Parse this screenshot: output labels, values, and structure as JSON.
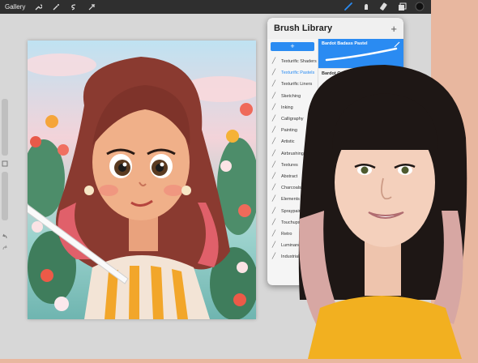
{
  "topbar": {
    "gallery_label": "Gallery",
    "left_icons": [
      "wrench-icon",
      "magic-wand-icon",
      "selection-s-icon",
      "arrow-transform-icon"
    ],
    "right_icons": [
      "brush-icon",
      "smudge-icon",
      "eraser-icon",
      "layers-icon",
      "color-swatch-icon"
    ]
  },
  "brush_library": {
    "title": "Brush Library",
    "add_symbol": "+",
    "new_set_symbol": "+",
    "sets": [
      {
        "label": "Texturific Shaders",
        "icon": "brush-stroke-icon",
        "selected": false
      },
      {
        "label": "Texturific Pastels",
        "icon": "brush-stroke-icon",
        "selected": true
      },
      {
        "label": "Texturific Liners",
        "icon": "brush-stroke-icon",
        "selected": false
      },
      {
        "label": "Sketching",
        "icon": "pencil-icon",
        "selected": false
      },
      {
        "label": "Inking",
        "icon": "ink-drop-icon",
        "selected": false
      },
      {
        "label": "Calligraphy",
        "icon": "calligraphy-icon",
        "selected": false
      },
      {
        "label": "Painting",
        "icon": "paint-drop-icon",
        "selected": false
      },
      {
        "label": "Artistic",
        "icon": "palette-icon",
        "selected": false
      },
      {
        "label": "Airbrushing",
        "icon": "airbrush-icon",
        "selected": false
      },
      {
        "label": "Textures",
        "icon": "texture-icon",
        "selected": false
      },
      {
        "label": "Abstract",
        "icon": "triangle-icon",
        "selected": false
      },
      {
        "label": "Charcoals",
        "icon": "charcoal-icon",
        "selected": false
      },
      {
        "label": "Elements",
        "icon": "yin-yang-icon",
        "selected": false
      },
      {
        "label": "Spraypaints",
        "icon": "spray-can-icon",
        "selected": false
      },
      {
        "label": "Touchups",
        "icon": "touchup-icon",
        "selected": false
      },
      {
        "label": "Retro",
        "icon": "retro-icon",
        "selected": false
      },
      {
        "label": "Luminance",
        "icon": "luminance-icon",
        "selected": false
      },
      {
        "label": "Industrial",
        "icon": "industrial-icon",
        "selected": false
      }
    ],
    "brushes": [
      {
        "name": "Bardot Badass Pastel",
        "selected": true
      },
      {
        "name": "Bardot Gossamer Pastel",
        "selected": false
      }
    ]
  },
  "colors": {
    "accent": "#2a8bf2",
    "topbar": "#2f2f2f",
    "background_peach": "#e8b79f"
  }
}
